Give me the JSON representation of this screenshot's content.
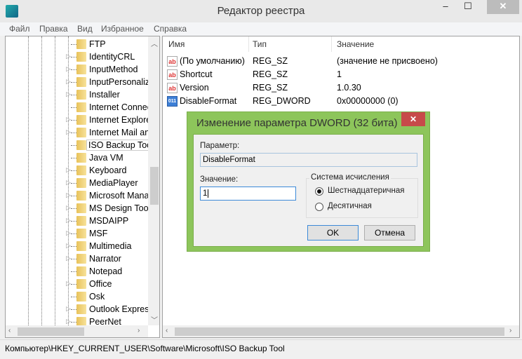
{
  "window": {
    "title": "Редактор реестра",
    "minimize": "–",
    "maximize": "☐",
    "close": "✕"
  },
  "menu": [
    "Файл",
    "Правка",
    "Вид",
    "Избранное",
    "Справка"
  ],
  "tree": {
    "items": [
      {
        "label": "FTP",
        "expandable": false
      },
      {
        "label": "IdentityCRL",
        "expandable": true
      },
      {
        "label": "InputMethod",
        "expandable": true
      },
      {
        "label": "InputPersonaliz",
        "expandable": true
      },
      {
        "label": "Installer",
        "expandable": true
      },
      {
        "label": "Internet Connec",
        "expandable": false
      },
      {
        "label": "Internet Explore",
        "expandable": true
      },
      {
        "label": "Internet Mail an",
        "expandable": true
      },
      {
        "label": "ISO Backup Too",
        "expandable": false,
        "selected": true
      },
      {
        "label": "Java VM",
        "expandable": false
      },
      {
        "label": "Keyboard",
        "expandable": true
      },
      {
        "label": "MediaPlayer",
        "expandable": true
      },
      {
        "label": "Microsoft Mana",
        "expandable": true
      },
      {
        "label": "MS Design Tool",
        "expandable": true
      },
      {
        "label": "MSDAIPP",
        "expandable": true
      },
      {
        "label": "MSF",
        "expandable": true
      },
      {
        "label": "Multimedia",
        "expandable": true
      },
      {
        "label": "Narrator",
        "expandable": true
      },
      {
        "label": "Notepad",
        "expandable": false
      },
      {
        "label": "Office",
        "expandable": true
      },
      {
        "label": "Osk",
        "expandable": false
      },
      {
        "label": "Outlook Express",
        "expandable": true
      },
      {
        "label": "PeerNet",
        "expandable": true
      }
    ]
  },
  "list": {
    "headers": [
      "Имя",
      "Тип",
      "Значение"
    ],
    "rows": [
      {
        "name": "(По умолчанию)",
        "type": "REG_SZ",
        "value": "(значение не присвоено)",
        "icon": "ab"
      },
      {
        "name": "Shortcut",
        "type": "REG_SZ",
        "value": "1",
        "icon": "ab"
      },
      {
        "name": "Version",
        "type": "REG_SZ",
        "value": "1.0.30",
        "icon": "ab"
      },
      {
        "name": "DisableFormat",
        "type": "REG_DWORD",
        "value": "0x00000000 (0)",
        "icon": "011"
      }
    ]
  },
  "status": "Компьютер\\HKEY_CURRENT_USER\\Software\\Microsoft\\ISO Backup Tool",
  "dialog": {
    "title": "Изменение параметра DWORD (32 бита)",
    "close": "✕",
    "param_label": "Параметр:",
    "param_value": "DisableFormat",
    "value_label": "Значение:",
    "value": "1",
    "radix_label": "Система исчисления",
    "hex": "Шестнадцатеричная",
    "dec": "Десятичная",
    "selected": "hex",
    "ok": "OK",
    "cancel": "Отмена"
  },
  "colors": {
    "dialog_frame": "#8dc55b",
    "close_red": "#c74a4a"
  }
}
